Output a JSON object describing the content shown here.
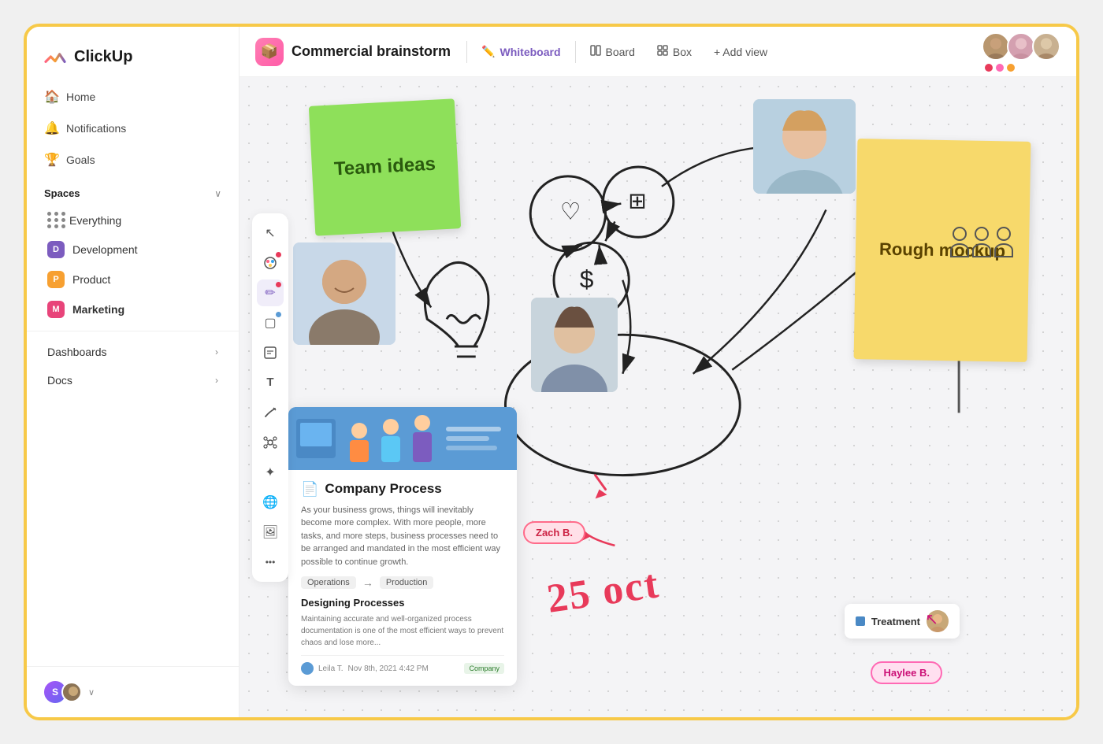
{
  "app": {
    "name": "ClickUp"
  },
  "sidebar": {
    "logo": "ClickUp",
    "nav": [
      {
        "id": "home",
        "label": "Home",
        "icon": "🏠"
      },
      {
        "id": "notifications",
        "label": "Notifications",
        "icon": "🔔"
      },
      {
        "id": "goals",
        "label": "Goals",
        "icon": "🏆"
      }
    ],
    "spaces_label": "Spaces",
    "spaces": [
      {
        "id": "everything",
        "label": "Everything",
        "color": ""
      },
      {
        "id": "development",
        "label": "Development",
        "color": "#7c5cbf",
        "letter": "D"
      },
      {
        "id": "product",
        "label": "Product",
        "color": "#f7a031",
        "letter": "P"
      },
      {
        "id": "marketing",
        "label": "Marketing",
        "color": "#e8447a",
        "letter": "M",
        "bold": true
      }
    ],
    "bottom_nav": [
      {
        "id": "dashboards",
        "label": "Dashboards"
      },
      {
        "id": "docs",
        "label": "Docs"
      }
    ],
    "footer": {
      "avatars": [
        "S",
        ""
      ]
    }
  },
  "topbar": {
    "project_icon": "📦",
    "title": "Commercial brainstorm",
    "views": [
      {
        "id": "whiteboard",
        "label": "Whiteboard",
        "icon": "✏️",
        "active": true
      },
      {
        "id": "board",
        "label": "Board",
        "icon": "▦"
      },
      {
        "id": "box",
        "label": "Box",
        "icon": "⊞"
      }
    ],
    "add_view_label": "+ Add view",
    "avatars": [
      "M1",
      "F1",
      "F2"
    ],
    "avatar_dots": [
      "#e83a5a",
      "#ff69b4",
      "#f7a031"
    ]
  },
  "canvas": {
    "sticky_green": {
      "text": "Team ideas"
    },
    "sticky_yellow": {
      "text": "Rough mockup"
    },
    "doc_card": {
      "title": "Company Process",
      "description": "As your business grows, things will inevitably become more complex. With more people, more tasks, and more steps, business processes need to be arranged and mandated in the most efficient way possible to continue growth.",
      "tags": [
        "Operations",
        "Production"
      ],
      "section_title": "Designing Processes",
      "section_text": "Maintaining accurate and well-organized process documentation is one of the most efficient ways to prevent chaos and lose more...",
      "footer_name": "Leila T.",
      "footer_date": "Nov 8th, 2021 4:42 PM",
      "footer_label": "Company"
    },
    "labels": {
      "zach": "Zach B.",
      "haylee": "Haylee B.",
      "treatment": "Treatment"
    },
    "date_text": "25 oct",
    "tools": [
      {
        "id": "cursor",
        "icon": "↖",
        "active": false
      },
      {
        "id": "palette",
        "icon": "🎨",
        "active": false,
        "dot": "#e83a5a"
      },
      {
        "id": "pencil",
        "icon": "✏",
        "active": true,
        "dot": "#e83a5a"
      },
      {
        "id": "square",
        "icon": "▢",
        "active": false,
        "dot": "#5b9bd5"
      },
      {
        "id": "note",
        "icon": "🗒",
        "active": false,
        "dot": ""
      },
      {
        "id": "text",
        "icon": "T",
        "active": false
      },
      {
        "id": "line",
        "icon": "⤴",
        "active": false
      },
      {
        "id": "network",
        "icon": "⬡",
        "active": false
      },
      {
        "id": "sparkle",
        "icon": "✦",
        "active": false
      },
      {
        "id": "globe",
        "icon": "🌐",
        "active": false
      },
      {
        "id": "image",
        "icon": "🖼",
        "active": false
      },
      {
        "id": "more",
        "icon": "•••",
        "active": false
      }
    ]
  }
}
